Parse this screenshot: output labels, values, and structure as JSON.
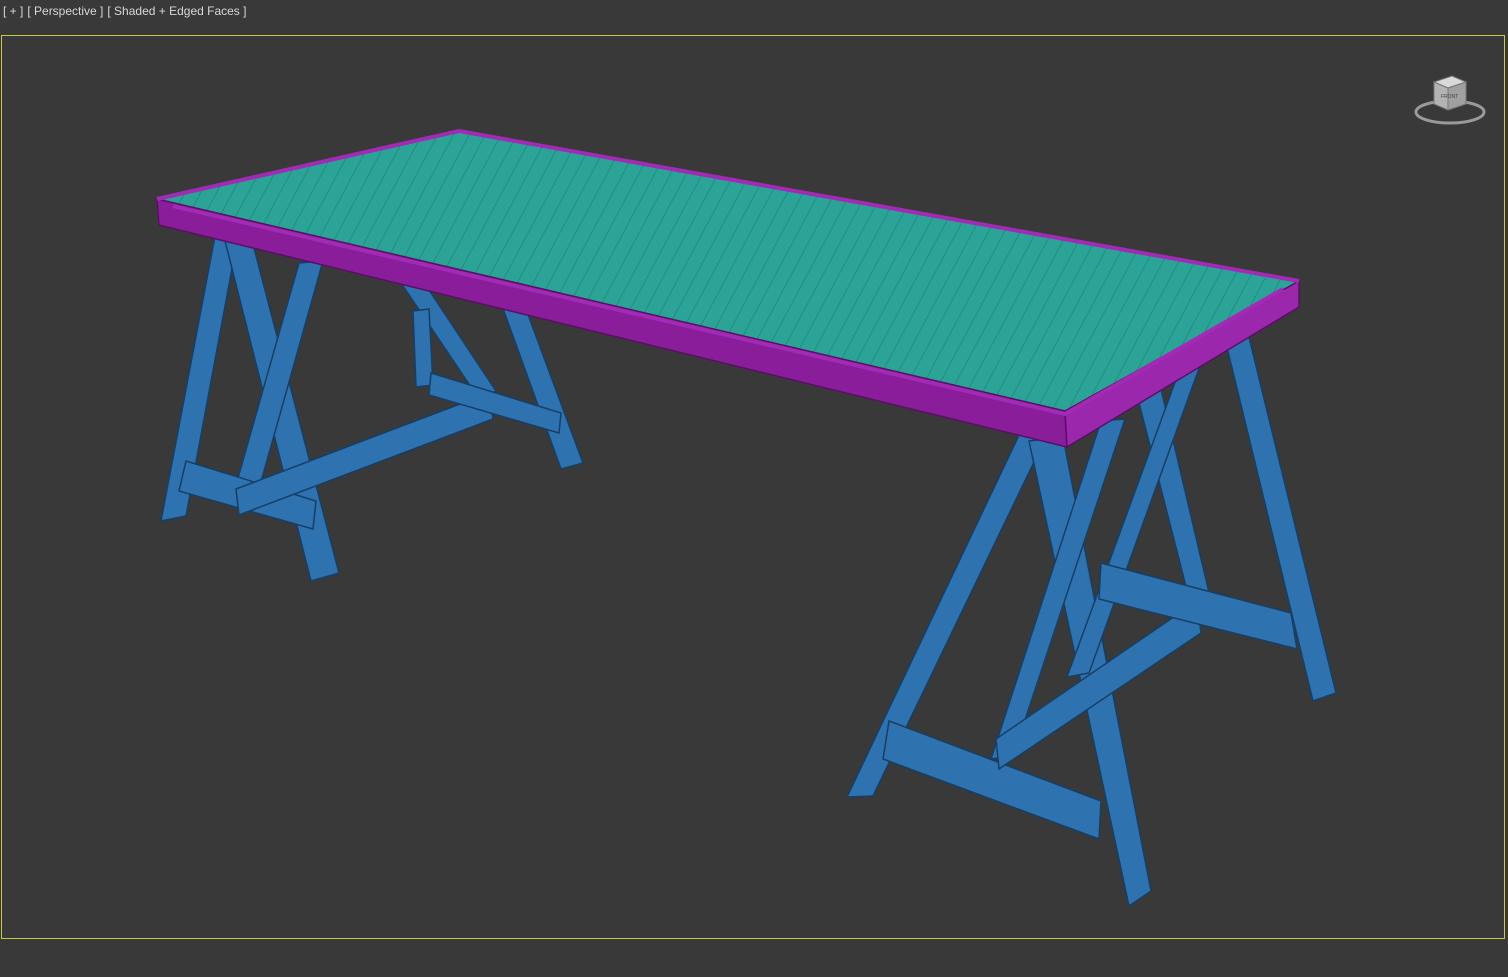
{
  "viewport": {
    "labels": [
      "[ + ]",
      "[ Perspective ]",
      "[ Shaded + Edged Faces ]"
    ],
    "active_border_color": "#c8c84a",
    "background_color": "#393939"
  },
  "viewcube": {
    "face_label": "FRONT",
    "icon": "viewcube-icon"
  },
  "scene": {
    "object": "trestle table",
    "colors": {
      "tabletop": "#2ba497",
      "tabletop_edge": "#8a1d9a",
      "legs": "#2f72b0"
    }
  }
}
